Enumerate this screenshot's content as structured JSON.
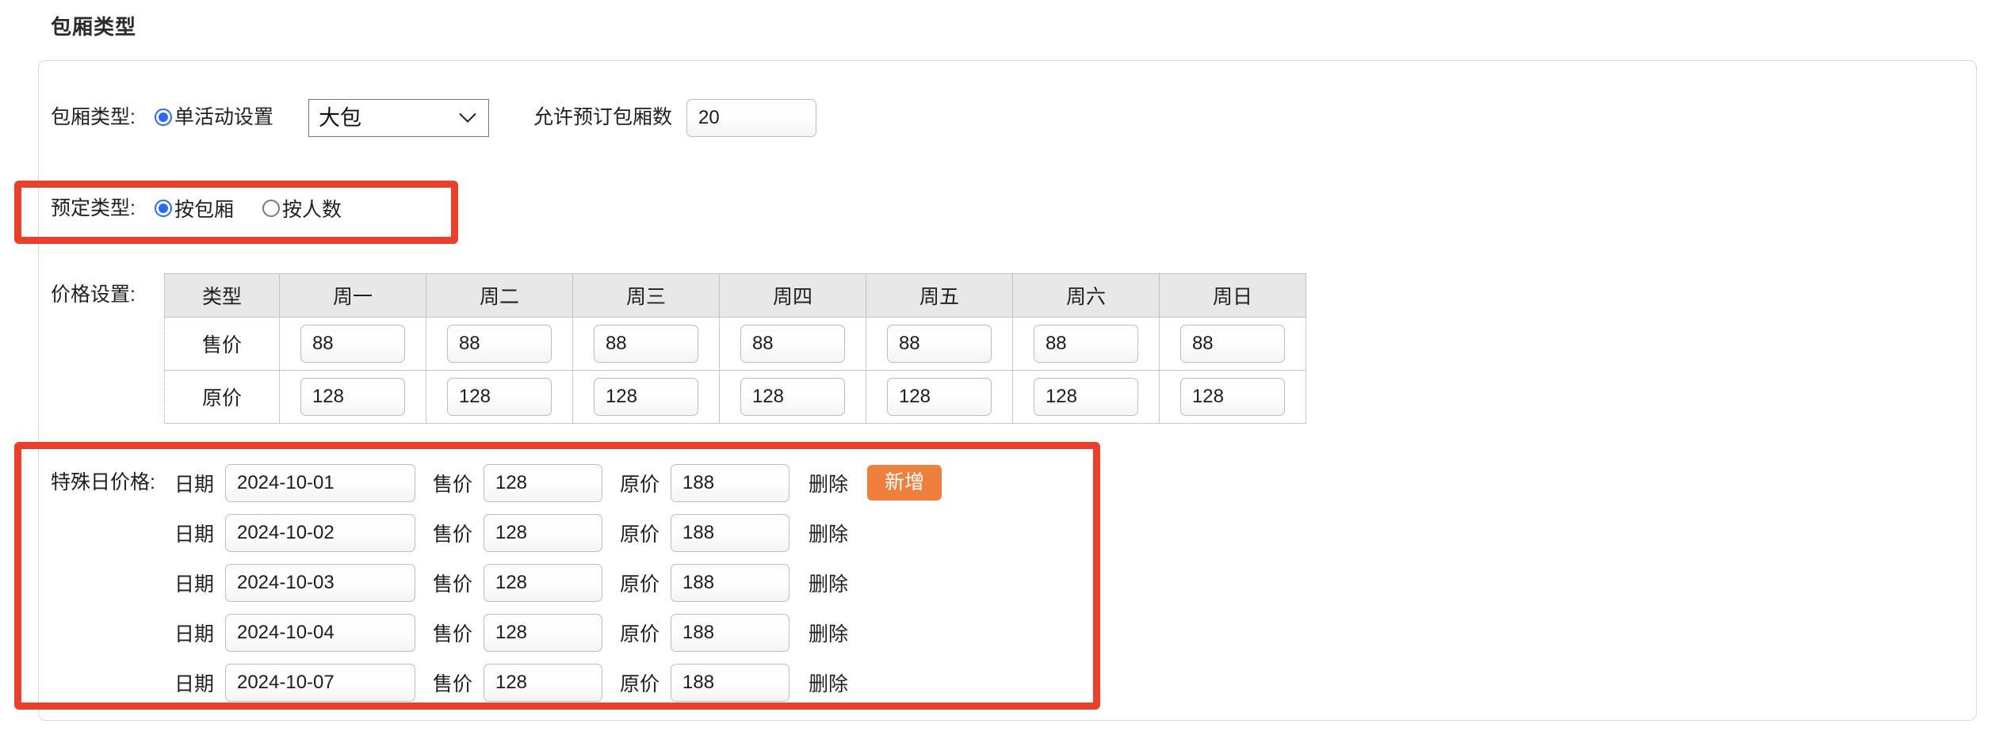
{
  "page": {
    "title": "包厢类型"
  },
  "room_type": {
    "label": "包厢类型:",
    "radio_label": "单活动设置",
    "radio_checked": true,
    "select_value": "大包",
    "select_options": [
      "大包"
    ],
    "count_label": "允许预订包厢数",
    "count_value": "20"
  },
  "booking_type": {
    "label": "预定类型:",
    "options": [
      {
        "label": "按包厢",
        "checked": true
      },
      {
        "label": "按人数",
        "checked": false
      }
    ]
  },
  "price_settings": {
    "label": "价格设置:",
    "headers": [
      "类型",
      "周一",
      "周二",
      "周三",
      "周四",
      "周五",
      "周六",
      "周日"
    ],
    "rows": [
      {
        "name": "售价",
        "values": [
          "88",
          "88",
          "88",
          "88",
          "88",
          "88",
          "88"
        ]
      },
      {
        "name": "原价",
        "values": [
          "128",
          "128",
          "128",
          "128",
          "128",
          "128",
          "128"
        ]
      }
    ]
  },
  "special_prices": {
    "label": "特殊日价格:",
    "date_label": "日期",
    "sale_label": "售价",
    "origin_label": "原价",
    "delete_label": "删除",
    "add_label": "新增",
    "rows": [
      {
        "date": "2024-10-01",
        "sale": "128",
        "origin": "188"
      },
      {
        "date": "2024-10-02",
        "sale": "128",
        "origin": "188"
      },
      {
        "date": "2024-10-03",
        "sale": "128",
        "origin": "188"
      },
      {
        "date": "2024-10-04",
        "sale": "128",
        "origin": "188"
      },
      {
        "date": "2024-10-07",
        "sale": "128",
        "origin": "188"
      }
    ]
  },
  "colors": {
    "annotation": "#e8402a",
    "add_button": "#ee7f3c",
    "radio_accent": "#2a6ce8"
  }
}
